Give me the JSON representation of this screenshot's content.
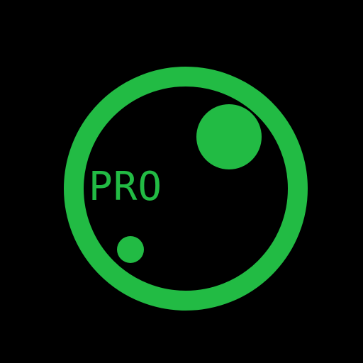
{
  "app_icon": {
    "label": "PRO",
    "icon_name": "lens-ring-icon",
    "colors": {
      "background": "#000000",
      "accent": "#22bb44"
    }
  }
}
